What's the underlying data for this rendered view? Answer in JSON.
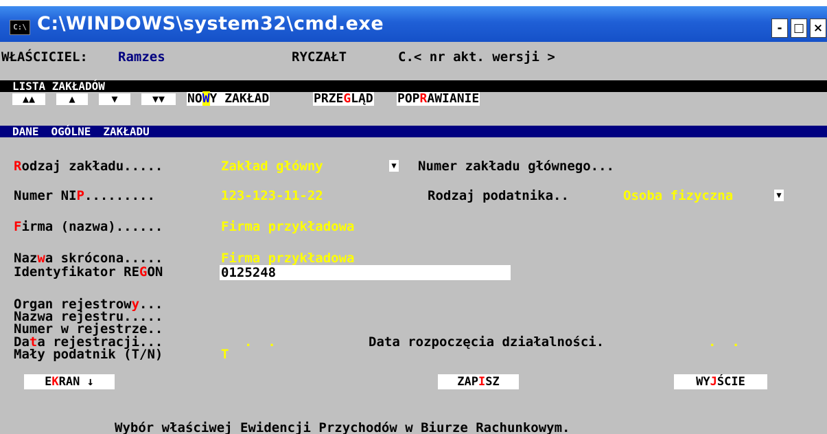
{
  "window": {
    "icon_label": "C:\\",
    "title": "C:\\WINDOWS\\system32\\cmd.exe",
    "minimize": "-",
    "maximize": "□",
    "close": "×"
  },
  "header": {
    "owner_label": "WŁAŚCICIEL:",
    "owner_value": "Ramzes",
    "ryczalt": "RYCZAŁT",
    "version": "C.< nr akt. wersji >"
  },
  "list_bar": {
    "title": "LISTA ZAKŁADÓW"
  },
  "nav": {
    "first": "▲▲",
    "prev": "▲",
    "next": "▼",
    "last": "▼▼",
    "new_pre": "NO",
    "new_hot": "W",
    "new_post": "Y ZAKŁAD",
    "browse_pre": "PRZE",
    "browse_hot": "G",
    "browse_post": "LĄD",
    "edit_pre": "POP",
    "edit_hot": "R",
    "edit_post": "AWIANIE"
  },
  "section": {
    "w1": "DANE",
    "w2": "OGÓLNE",
    "w3": "ZAKŁADU"
  },
  "form": {
    "type_hot": "R",
    "type_rest": "odzaj zakładu.....",
    "type_value": "Zakład główny",
    "main_no_label": "Numer zakładu głównego...",
    "nip_pre": "Numer NI",
    "nip_hot": "P",
    "nip_post": ".........",
    "nip_value": "123-123-11-22",
    "taxpayer_label": "Rodzaj podatnika..",
    "taxpayer_value": "Osoba fizyczna",
    "firm_hot": "F",
    "firm_rest": "irma (nazwa)......",
    "firm_value": "Firma przykładowa",
    "short_pre": "Naz",
    "short_hot": "w",
    "short_post": "a skrócona.....",
    "short_value": "Firma przykładowa",
    "regon_pre": "Identyfikator RE",
    "regon_hot": "G",
    "regon_post": "ON",
    "regon_value": "0125248",
    "organ_pre": "Organ rejestrow",
    "organ_hot": "y",
    "organ_post": "...",
    "register_name": "Nazwa rejestru.....",
    "register_no": "Numer w rejestrze..",
    "regdate_pre": "Da",
    "regdate_hot": "t",
    "regdate_post": "a rejestracji...",
    "regdate_value": ".  .",
    "startdate_label": "Data rozpoczęcia działalności.",
    "startdate_value": ".  .",
    "small_label": "Mały podatnik (T/N)",
    "small_value": "T"
  },
  "actions": {
    "screen_pre": "E",
    "screen_hot": "K",
    "screen_post": "RAN ↓",
    "save_pre": "ZAP",
    "save_hot": "I",
    "save_post": "SZ",
    "exit_pre": "WY",
    "exit_hot": "J",
    "exit_post": "ŚCIE"
  },
  "status_line": "Wybór właściwej Ewidencji Przychodów w Biurze Rachunkowym.",
  "icons": {
    "dropdown": "dropdown-arrow-icon",
    "console": "console-icon"
  },
  "colors": {
    "title_bar": "#1f5fd6",
    "console_bg": "#c0c0c0",
    "hotkey": "#ff0000",
    "field_value": "#ffff00",
    "section_bar": "#000080"
  }
}
